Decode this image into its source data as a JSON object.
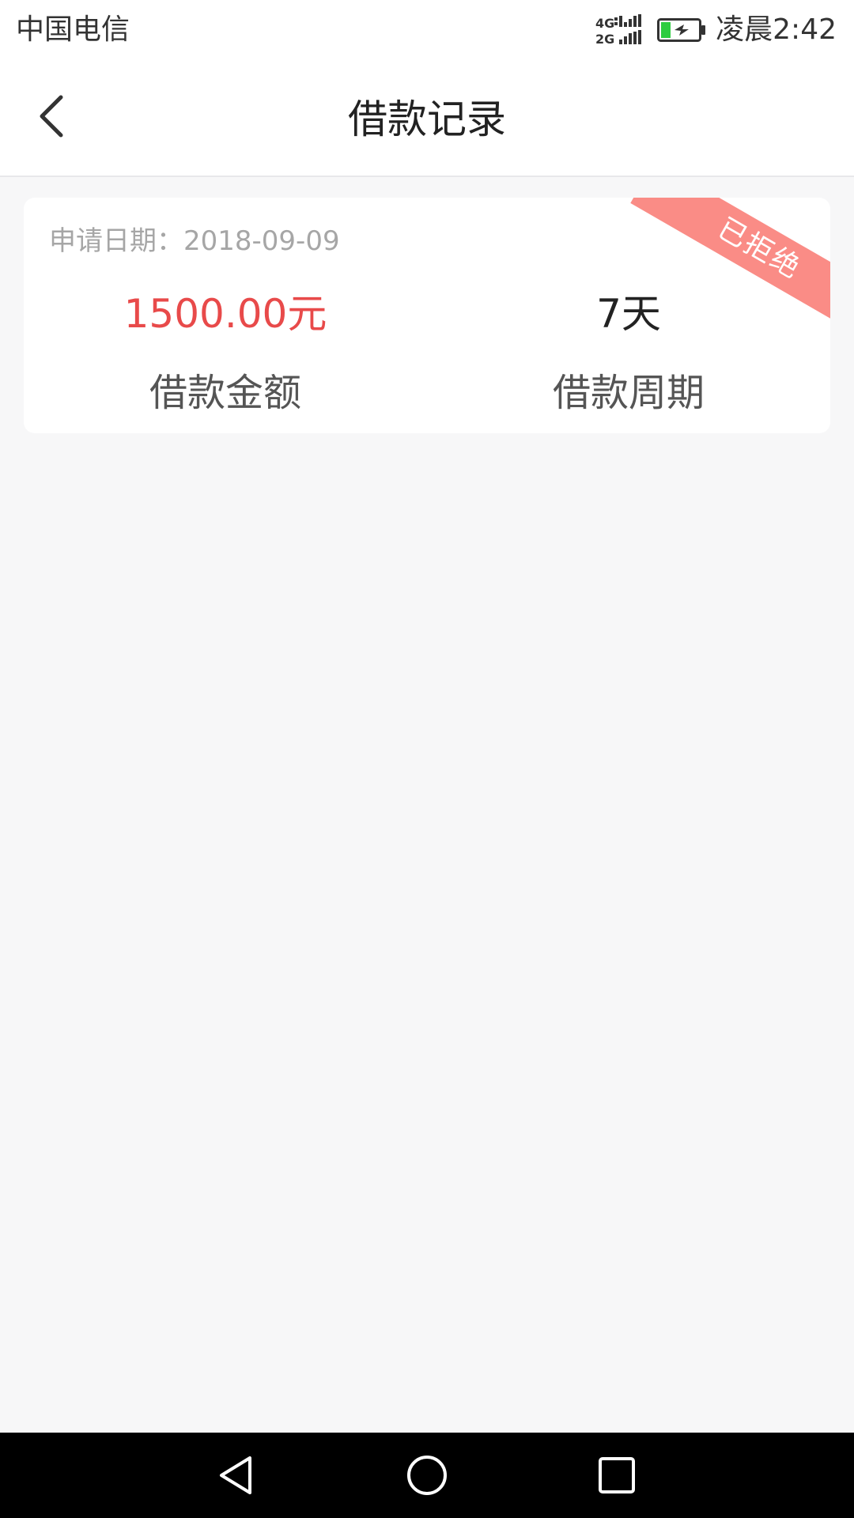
{
  "status_bar": {
    "carrier": "中国电信",
    "clock": "凌晨2:42",
    "network_icon": "signal-4g-2g-icon",
    "battery_icon": "battery-charging-icon",
    "battery_color": "#2ecc40"
  },
  "header": {
    "title": "借款记录",
    "back_icon": "chevron-left-icon"
  },
  "records": [
    {
      "status": "已拒绝",
      "status_color": "#fa8c86",
      "apply_date": "申请日期：2018-09-09",
      "amount_value": "1500.00元",
      "amount_label": "借款金额",
      "period_value": "7天",
      "period_label": "借款周期",
      "amount_color": "#e84a4a"
    }
  ],
  "system_nav": {
    "back_icon": "triangle-back-icon",
    "home_icon": "circle-home-icon",
    "recent_icon": "square-recent-icon"
  }
}
